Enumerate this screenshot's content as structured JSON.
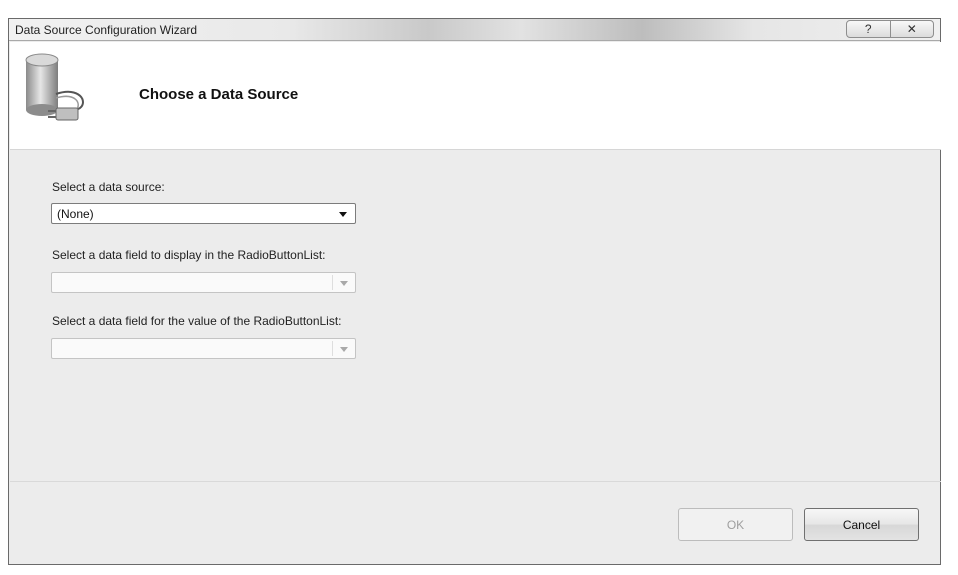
{
  "window": {
    "title": "Data Source Configuration Wizard",
    "help_glyph": "?",
    "close_glyph": "✕"
  },
  "header": {
    "title": "Choose a Data Source",
    "icon": "database-plug-icon"
  },
  "form": {
    "data_source_label": "Select a data source:",
    "data_source_value": "(None)",
    "display_field_label": "Select a data field to display in the RadioButtonList:",
    "display_field_value": "",
    "value_field_label": "Select a data field for the value of the RadioButtonList:",
    "value_field_value": ""
  },
  "footer": {
    "ok_label": "OK",
    "cancel_label": "Cancel"
  }
}
